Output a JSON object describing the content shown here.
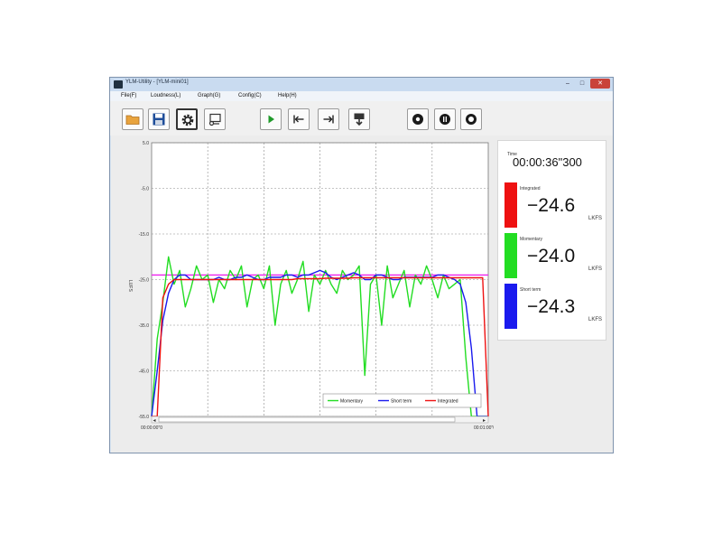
{
  "window": {
    "title": "YLM-Utility - [YLM-mini01]"
  },
  "menu": [
    {
      "label": "File(F)"
    },
    {
      "label": "Loudness(L)"
    },
    {
      "label": "Graph(G)"
    },
    {
      "label": "Config(C)"
    },
    {
      "label": "Help(H)"
    }
  ],
  "toolbar": [
    {
      "name": "open-folder-button",
      "icon": "folder-icon"
    },
    {
      "name": "save-button",
      "icon": "floppy-disk-icon"
    },
    {
      "name": "settings-button",
      "icon": "gear-icon"
    },
    {
      "name": "device-button",
      "icon": "device-icon"
    },
    {
      "name": "play-button",
      "icon": "play-icon"
    },
    {
      "name": "go-to-start-button",
      "icon": "skip-start-icon"
    },
    {
      "name": "go-to-end-button",
      "icon": "skip-end-icon"
    },
    {
      "name": "download-button",
      "icon": "download-icon"
    },
    {
      "name": "record-button",
      "icon": "circle-icon"
    },
    {
      "name": "pause-button",
      "icon": "pause-circle-icon"
    },
    {
      "name": "stop-button",
      "icon": "ring-icon"
    }
  ],
  "colors": {
    "momentary": "#22dd22",
    "short_term": "#1a1aee",
    "integrated": "#ee1111",
    "target_line": "#ee22ee"
  },
  "chart_data": {
    "type": "line",
    "ylabel": "LUFS",
    "ylim": [
      -55,
      5
    ],
    "y_ticks": [
      "5.0",
      "-5.0",
      "-15.0",
      "-25.0",
      "-35.0",
      "-45.0",
      "-55.0"
    ],
    "x_ticks": [
      "00:00:00\"0",
      "00:01:00\"0"
    ],
    "grid": true,
    "legend": "bottom-right",
    "target_level": -24,
    "x": [
      0,
      1,
      2,
      3,
      4,
      5,
      6,
      7,
      8,
      9,
      10,
      11,
      12,
      13,
      14,
      15,
      16,
      17,
      18,
      19,
      20,
      21,
      22,
      23,
      24,
      25,
      26,
      27,
      28,
      29,
      30,
      31,
      32,
      33,
      34,
      35,
      36,
      37,
      38,
      39,
      40,
      41,
      42,
      43,
      44,
      45,
      46,
      47,
      48,
      49,
      50,
      51,
      52,
      53,
      54,
      55,
      56,
      57,
      58,
      59,
      60
    ],
    "series": [
      {
        "name": "Momentary",
        "values": [
          -55,
          -38,
          -30,
          -20,
          -26,
          -23,
          -31,
          -27,
          -22,
          -25,
          -24,
          -30,
          -25,
          -27,
          -23,
          -25,
          -22,
          -31,
          -25,
          -24,
          -27,
          -22,
          -35,
          -26,
          -23,
          -28,
          -25,
          -21,
          -32,
          -24,
          -26,
          -23,
          -26,
          -28,
          -23,
          -25,
          -24,
          -22,
          -46,
          -26,
          -24,
          -35,
          -22,
          -29,
          -26,
          -23,
          -31,
          -24,
          -26,
          -22,
          -25,
          -29,
          -24,
          -27,
          -26,
          -25,
          -42,
          -55,
          -55,
          -55,
          -55
        ]
      },
      {
        "name": "Short term",
        "values": [
          -55,
          -45,
          -34,
          -28,
          -25,
          -24,
          -24,
          -25,
          -25,
          -25,
          -25,
          -25,
          -24.5,
          -25,
          -25,
          -24.5,
          -24.5,
          -24,
          -24.5,
          -25,
          -25,
          -24.5,
          -24.5,
          -24.5,
          -24,
          -24,
          -24.5,
          -24,
          -24,
          -23.5,
          -23,
          -23.5,
          -24.5,
          -25,
          -24.5,
          -24,
          -23.5,
          -24,
          -25,
          -25,
          -24,
          -24,
          -24.5,
          -25,
          -25,
          -24.5,
          -24.5,
          -24.5,
          -24.5,
          -24.5,
          -24.5,
          -24,
          -24,
          -24.5,
          -25,
          -26,
          -30,
          -40,
          -55,
          -55,
          -55
        ]
      },
      {
        "name": "Integrated",
        "values": [
          -55,
          -55,
          -29,
          -26,
          -25,
          -25,
          -25,
          -25,
          -25,
          -25,
          -25,
          -25,
          -25,
          -25,
          -25,
          -25,
          -25,
          -25,
          -25,
          -25,
          -25,
          -25,
          -25,
          -25,
          -25,
          -25,
          -24.8,
          -24.8,
          -24.8,
          -24.8,
          -24.8,
          -24.7,
          -24.7,
          -24.7,
          -24.7,
          -24.7,
          -24.6,
          -24.6,
          -24.6,
          -24.6,
          -24.6,
          -24.6,
          -24.6,
          -24.6,
          -24.6,
          -24.6,
          -24.6,
          -24.6,
          -24.6,
          -24.6,
          -24.6,
          -24.6,
          -24.6,
          -24.6,
          -24.6,
          -24.6,
          -24.6,
          -24.6,
          -24.6,
          -24.6,
          -55
        ]
      }
    ]
  },
  "panel": {
    "time_label": "Time",
    "time_value": "00:00:36\"300",
    "integrated": {
      "label": "Integrated",
      "value": "−24.6",
      "unit": "LKFS"
    },
    "momentary": {
      "label": "Momentary",
      "value": "−24.0",
      "unit": "LKFS"
    },
    "short_term": {
      "label": "Short term",
      "value": "−24.3",
      "unit": "LKFS"
    }
  }
}
